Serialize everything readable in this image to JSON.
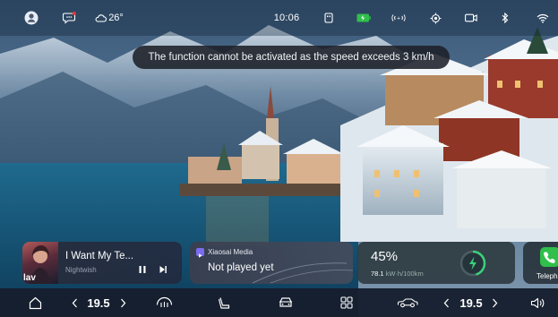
{
  "status_bar": {
    "weather_temp": "26°",
    "time": "10:06",
    "icons": [
      "user-avatar-icon",
      "message-icon",
      "cloud-icon",
      "usb-icon",
      "battery-icon",
      "signal-broadcast-icon",
      "location-icon",
      "camera-icon",
      "bluetooth-icon",
      "wifi-icon"
    ]
  },
  "toast": {
    "message": "The function cannot be activated as the speed exceeds 3 km/h"
  },
  "music_card": {
    "cover_text": "lav",
    "title": "I Want My Te...",
    "artist": "Nightwish",
    "icons": [
      "pause-icon",
      "next-track-icon"
    ]
  },
  "media_card": {
    "app_name": "Xiaosai Media",
    "status": "Not played yet"
  },
  "energy_card": {
    "percent": "45%",
    "consumption_value": "78.1",
    "consumption_unit": "kW·h/100km",
    "accent_color": "#3ad07a"
  },
  "phone_card": {
    "label": "Teleph",
    "accent_color": "#2fbf4a"
  },
  "dock": {
    "left_temp": "19.5",
    "right_temp": "19.5",
    "icons": [
      "home-icon",
      "defrost-icon",
      "seat-icon",
      "car-icon",
      "apps-grid-icon",
      "car-side-icon",
      "volume-icon"
    ]
  }
}
